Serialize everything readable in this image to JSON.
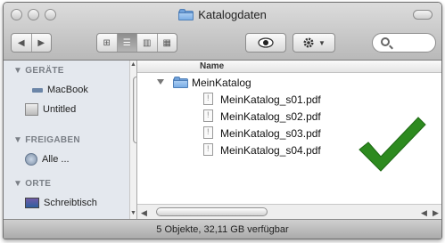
{
  "window": {
    "title": "Katalogdaten"
  },
  "toolbar": {
    "view_buttons": [
      "⊞",
      "☰",
      "▥",
      "▦"
    ],
    "eye_icon": "eye-icon",
    "action_icon": "gear-icon"
  },
  "sidebar": {
    "sections": [
      {
        "label": "▼ GERÄTE",
        "items": [
          {
            "label": "MacBook"
          },
          {
            "label": "Untitled"
          }
        ]
      },
      {
        "label": "▼ FREIGABEN",
        "items": [
          {
            "label": "Alle ..."
          }
        ]
      },
      {
        "label": "▼ ORTE",
        "items": [
          {
            "label": "Schreibtisch"
          }
        ]
      }
    ]
  },
  "list": {
    "column_name": "Name",
    "folder": "MeinKatalog",
    "files": [
      "MeinKatalog_s01.pdf",
      "MeinKatalog_s02.pdf",
      "MeinKatalog_s03.pdf",
      "MeinKatalog_s04.pdf"
    ]
  },
  "status": {
    "text": "5 Objekte, 32,11 GB verfügbar"
  },
  "colors": {
    "check": "#2d8a1f",
    "folder": "#6fa0d9",
    "sidebar_bg": "#e4e8ee"
  }
}
